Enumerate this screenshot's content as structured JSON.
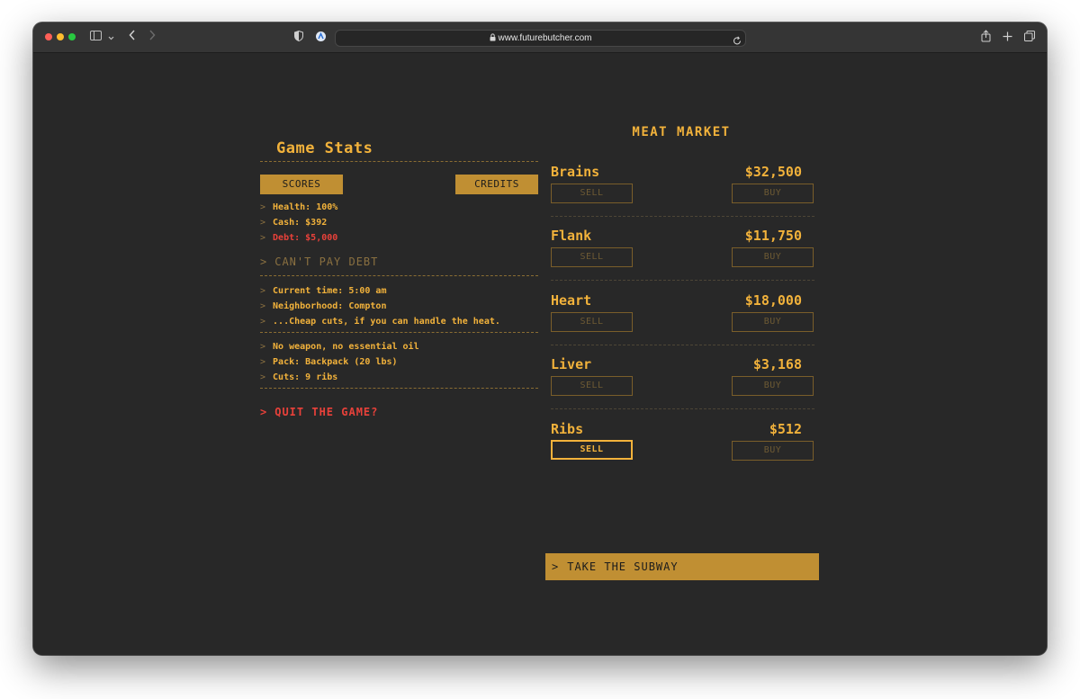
{
  "browser": {
    "url": "www.futurebutcher.com",
    "icons": [
      "sidebar-icon",
      "chevron-down-icon",
      "back-icon",
      "forward-icon",
      "shield-icon",
      "extension-icon",
      "lock-icon",
      "reload-icon",
      "share-icon",
      "plus-icon",
      "tabs-icon"
    ]
  },
  "stats": {
    "title": "Game Stats",
    "scores_label": "SCORES",
    "credits_label": "CREDITS",
    "prompt": ">",
    "health": "Health: 100%",
    "cash": "Cash: $392",
    "debt": "Debt: $5,000",
    "cant_pay": "CAN'T PAY DEBT",
    "time": "Current time: 5:00 am",
    "neighborhood": "Neighborhood: Compton",
    "flavor": "...Cheap cuts, if you can handle the heat.",
    "weapon": "No weapon, no essential oil",
    "pack": "Pack: Backpack (20 lbs)",
    "cuts": "Cuts: 9 ribs",
    "quit": "QUIT THE GAME?"
  },
  "market": {
    "title": "MEAT MARKET",
    "sell_label": "SELL",
    "buy_label": "BUY",
    "items": [
      {
        "name": "Brains",
        "price": "$32,500"
      },
      {
        "name": "Flank",
        "price": "$11,750"
      },
      {
        "name": "Heart",
        "price": "$18,000"
      },
      {
        "name": "Liver",
        "price": "$3,168"
      },
      {
        "name": "Ribs",
        "price": "$512"
      }
    ],
    "subway": "TAKE THE SUBWAY"
  },
  "colors": {
    "accent": "#f2b23b",
    "button_fill": "#c08f33",
    "danger": "#e8413a",
    "background": "#282828"
  }
}
